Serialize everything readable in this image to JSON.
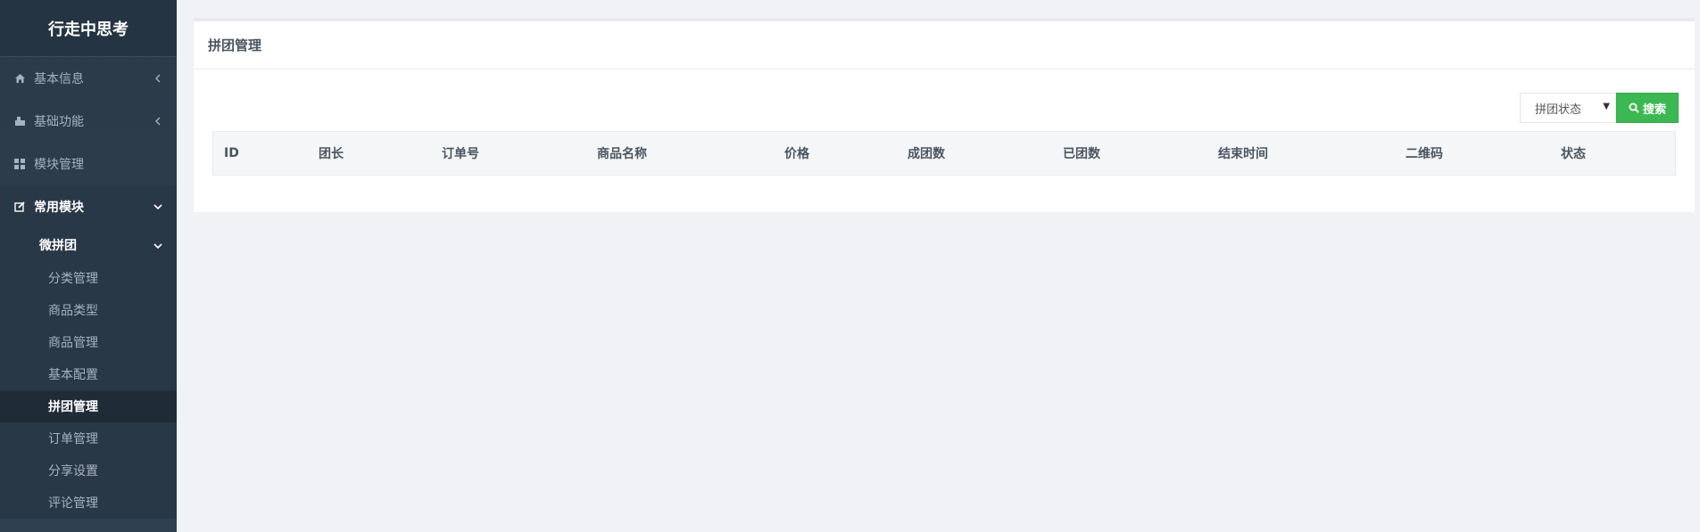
{
  "sidebar": {
    "brand": "行走中思考",
    "items": [
      {
        "label": "基本信息",
        "icon": "home-icon"
      },
      {
        "label": "基础功能",
        "icon": "puzzle-icon"
      },
      {
        "label": "模块管理",
        "icon": "grid-icon"
      },
      {
        "label": "常用模块",
        "icon": "edit-icon"
      }
    ],
    "sub_group": {
      "label": "微拼团",
      "items": [
        {
          "label": "分类管理"
        },
        {
          "label": "商品类型"
        },
        {
          "label": "商品管理"
        },
        {
          "label": "基本配置"
        },
        {
          "label": "拼团管理"
        },
        {
          "label": "订单管理"
        },
        {
          "label": "分享设置"
        },
        {
          "label": "评论管理"
        }
      ],
      "active": "拼团管理"
    }
  },
  "panel": {
    "title": "拼团管理"
  },
  "toolbar": {
    "status_select": "拼团状态",
    "search_label": "搜索"
  },
  "table": {
    "columns": [
      "ID",
      "团长",
      "订单号",
      "商品名称",
      "价格",
      "成团数",
      "已团数",
      "结束时间",
      "二维码",
      "状态"
    ]
  },
  "colors": {
    "sidebar_bg": "#2f4050",
    "search_button": "#3cb853",
    "page_bg": "#f0f2f6"
  }
}
